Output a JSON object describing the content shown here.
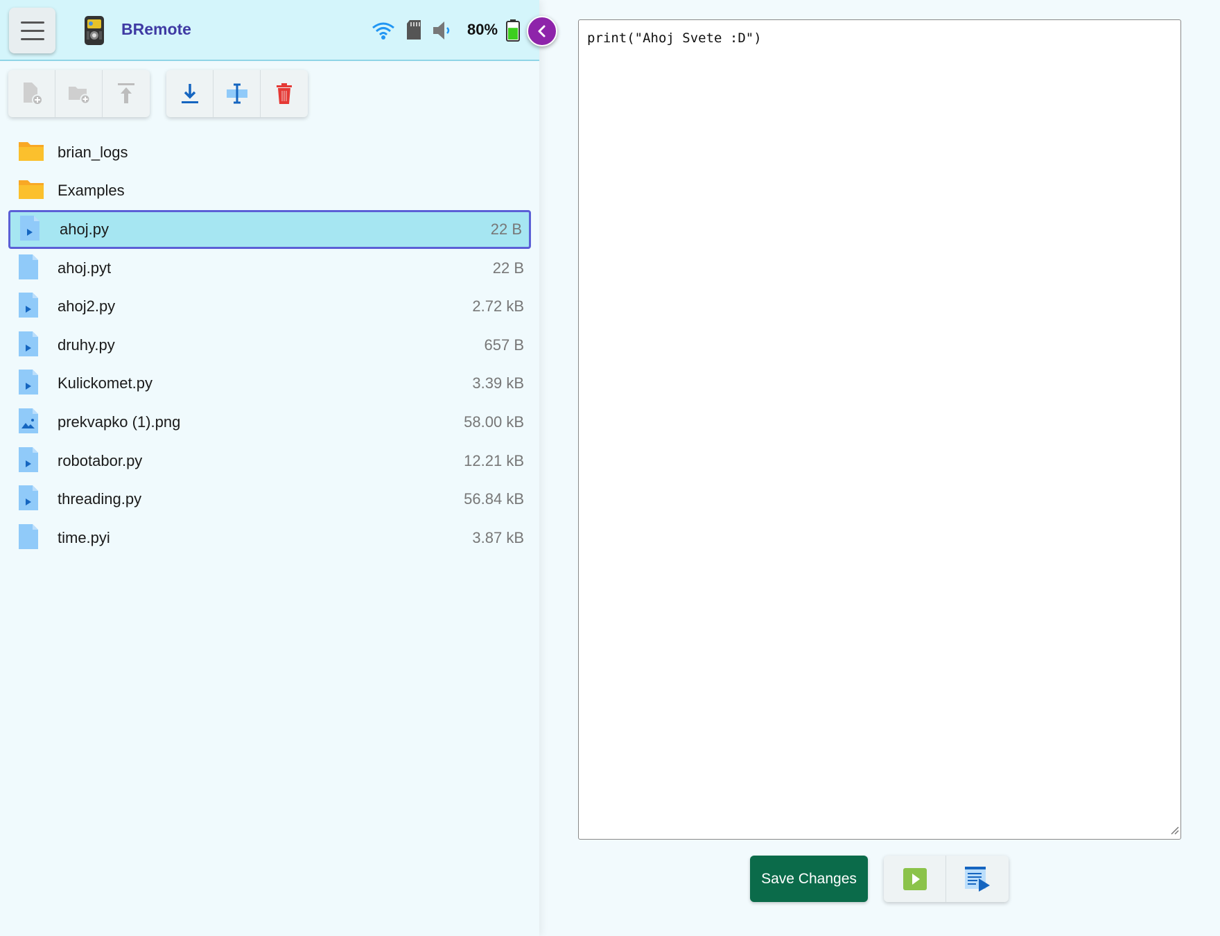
{
  "header": {
    "app_title": "BRemote",
    "battery_percent": "80%",
    "battery_level": 0.8,
    "icons": [
      "menu-icon",
      "brick-logo-icon",
      "wifi-icon",
      "sd-card-icon",
      "speaker-icon",
      "battery-icon",
      "chevron-left-icon"
    ]
  },
  "toolbar": {
    "left_group": [
      "new-file-icon",
      "new-folder-icon",
      "upload-icon"
    ],
    "right_group": [
      "download-icon",
      "rename-icon",
      "delete-icon"
    ]
  },
  "files": [
    {
      "name": "brian_logs",
      "size": "",
      "type": "folder"
    },
    {
      "name": "Examples",
      "size": "",
      "type": "folder"
    },
    {
      "name": "ahoj.py",
      "size": "22 B",
      "type": "python",
      "selected": true
    },
    {
      "name": "ahoj.pyt",
      "size": "22 B",
      "type": "file"
    },
    {
      "name": "ahoj2.py",
      "size": "2.72 kB",
      "type": "python"
    },
    {
      "name": "druhy.py",
      "size": "657 B",
      "type": "python"
    },
    {
      "name": "Kulickomet.py",
      "size": "3.39 kB",
      "type": "python"
    },
    {
      "name": "prekvapko (1).png",
      "size": "58.00 kB",
      "type": "image"
    },
    {
      "name": "robotabor.py",
      "size": "12.21 kB",
      "type": "python"
    },
    {
      "name": "threading.py",
      "size": "56.84 kB",
      "type": "python"
    },
    {
      "name": "time.pyi",
      "size": "3.87 kB",
      "type": "file"
    }
  ],
  "editor": {
    "content": "print(\"Ahoj Svete :D\")"
  },
  "actions": {
    "save_label": "Save Changes",
    "icons": [
      "run-icon",
      "run-with-output-icon"
    ]
  },
  "colors": {
    "header_bg": "#d4f5fb",
    "title": "#3f3aa3",
    "selected_row": "#a6e6f2",
    "selected_border": "#5b5fd6",
    "save_button": "#0b6b4a",
    "collapse_button": "#8e24aa",
    "folder": "#fbc02d",
    "file": "#90caf9"
  }
}
